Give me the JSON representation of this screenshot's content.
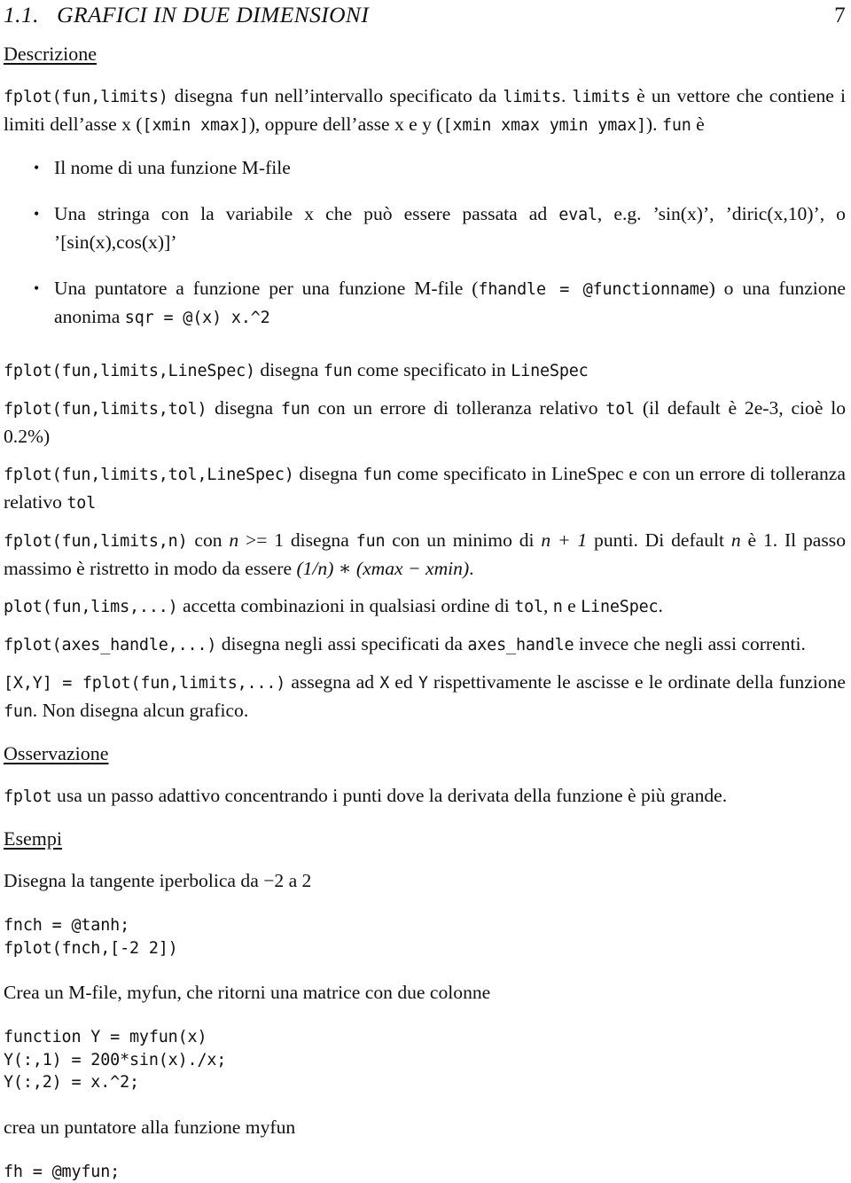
{
  "header": {
    "section_number": "1.1.",
    "section_title": "GRAFICI IN DUE DIMENSIONI",
    "running_head": "1.1.   GRAFICI IN DUE DIMENSIONI",
    "page_number": "7"
  },
  "sections": {
    "descrizione_title": "Descrizione",
    "osservazione_title": "Osservazione",
    "esempi_title": "Esempi"
  },
  "paragraphs": {
    "intro": {
      "sig": "fplot(fun,limits)",
      "t1": " disegna ",
      "c1": "fun",
      "t2": " nell’intervallo specificato da ",
      "c2": "limits",
      "t3": ".  ",
      "c3": "limits",
      "t4": " è un vettore che contiene i limiti dell’asse x (",
      "c4": "[xmin xmax]",
      "t5": "), oppure dell’asse x e y (",
      "c5": "[xmin xmax ymin ymax]",
      "t6": "). ",
      "c6": "fun",
      "t7": " è"
    },
    "linespec": {
      "sig": "fplot(fun,limits,LineSpec)",
      "t1": " disegna ",
      "c1": "fun",
      "t2": " come specificato in ",
      "c2": "LineSpec"
    },
    "tol": {
      "sig": "fplot(fun,limits,tol)",
      "t1": " disegna ",
      "c1": "fun",
      "t2": " con un errore di tolleranza relativo ",
      "c2": "tol",
      "t3": " (il default è 2e-3, cioè lo 0.2%)"
    },
    "tol_linespec": {
      "sig": "fplot(fun,limits,tol,LineSpec)",
      "t1": " disegna ",
      "c1": "fun",
      "t2": " come specificato in LineSpec e con un errore di tolleranza relativo ",
      "c2": "tol"
    },
    "npoints": {
      "sig": "fplot(fun,limits,n)",
      "t1": " con ",
      "m1": "n",
      "t2": " >= 1 disegna ",
      "c1": "fun",
      "t3": " con un minimo di ",
      "m2": "n + 1",
      "t4": " punti. Di default ",
      "m3": "n",
      "t5": " è 1. Il passo massimo è ristretto in modo da essere ",
      "m4": "(1/n) ∗ (xmax − xmin)",
      "t6": "."
    },
    "combinazioni": {
      "sig": "plot(fun,lims,...)",
      "t1": " accetta combinazioni in qualsiasi ordine di ",
      "c1": "tol",
      "t2": ", ",
      "c2": "n",
      "t3": " e ",
      "c3": "LineSpec",
      "t4": "."
    },
    "axes_handle": {
      "sig": "fplot(axes_handle,...)",
      "t1": "   disegna negli assi specificati da ",
      "c1": "axes_handle",
      "t2": " invece che negli assi correnti."
    },
    "xy_output": {
      "sig": "[X,Y] = fplot(fun,limits,...)",
      "t1": " assegna ad ",
      "c1": "X",
      "t2": " ed ",
      "c2": "Y",
      "t3": " rispettivamente le ascisse e le ordinate della funzione ",
      "c3": "fun",
      "t4": ". Non disegna alcun grafico."
    },
    "osservazione_body": {
      "c1": "fplot",
      "t1": " usa un passo adattivo concentrando i punti dove la derivata della funzione è più grande."
    },
    "esempio1_caption": "Disegna la tangente iperbolica da −2 a 2",
    "esempio2_caption": "Crea un M-file, myfun, che ritorni una matrice con due colonne",
    "esempio3_caption": "crea un puntatore alla funzione myfun"
  },
  "bullets": [
    {
      "t1": "Il nome di una funzione M-file"
    },
    {
      "t1": "Una stringa con la variabile x che può essere passata ad ",
      "c1": "eval",
      "t2": ", e.g. ’sin(x)’, ’diric(x,10)’, o ’[sin(x),cos(x)]’"
    },
    {
      "t1": "Una puntatore a funzione per una funzione M-file (",
      "c1": "fhandle = @functionname",
      "t2": ") o una funzione anonima ",
      "c2": "sqr = @(x) x.^2"
    }
  ],
  "code_blocks": {
    "tanh_example": "fnch = @tanh;\nfplot(fnch,[-2 2])",
    "myfun_example": "function Y = myfun(x)\nY(:,1) = 200*sin(x)./x;\nY(:,2) = x.^2;",
    "handle_example": "fh = @myfun;"
  }
}
